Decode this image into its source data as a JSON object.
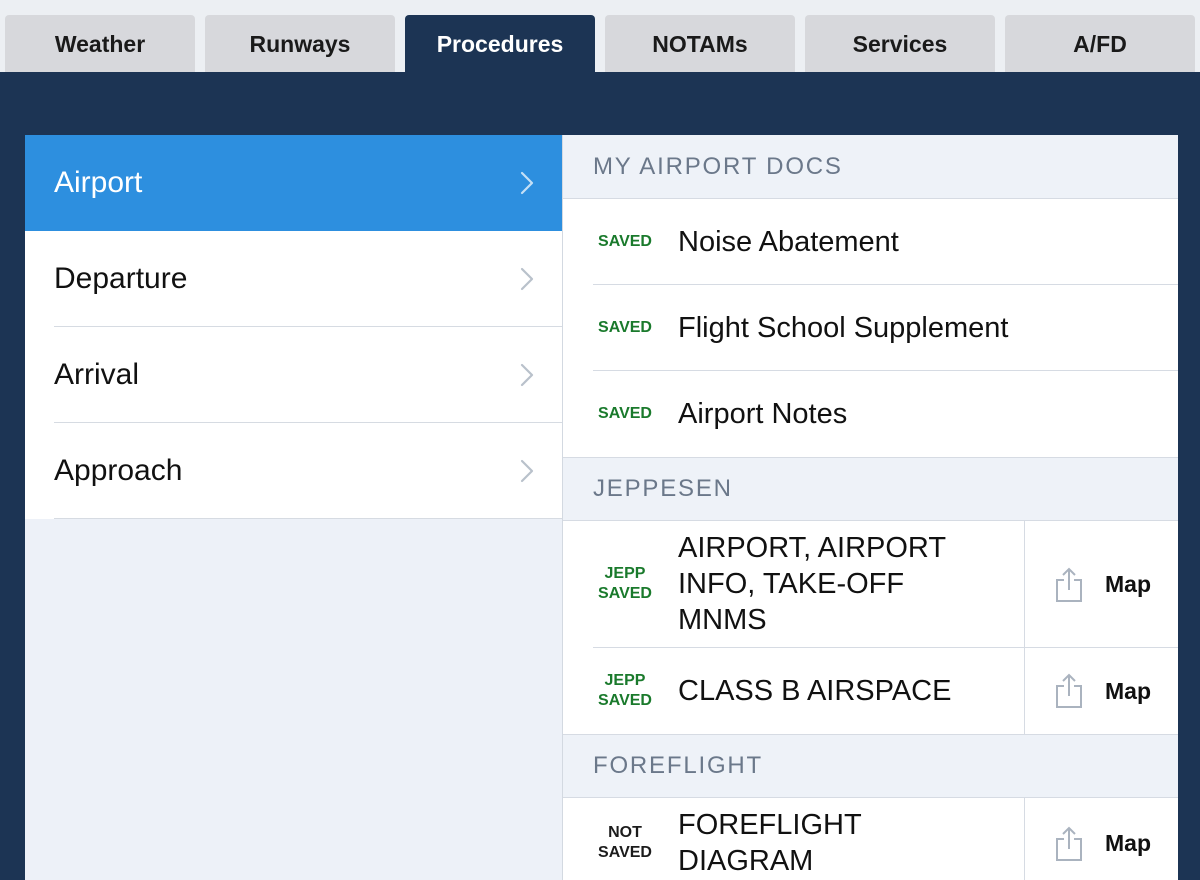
{
  "tabs": [
    {
      "label": "Weather",
      "active": false
    },
    {
      "label": "Runways",
      "active": false
    },
    {
      "label": "Procedures",
      "active": true
    },
    {
      "label": "NOTAMs",
      "active": false
    },
    {
      "label": "Services",
      "active": false
    },
    {
      "label": "A/FD",
      "active": false
    }
  ],
  "sidebar": {
    "item_icon": "chevron-right-icon",
    "items": [
      {
        "label": "Airport",
        "selected": true
      },
      {
        "label": "Departure",
        "selected": false
      },
      {
        "label": "Arrival",
        "selected": false
      },
      {
        "label": "Approach",
        "selected": false
      }
    ]
  },
  "documents": {
    "action_icon": "share-icon",
    "sections": [
      {
        "header": "MY AIRPORT DOCS",
        "rows": [
          {
            "status": "SAVED",
            "saved": true,
            "title": "Noise Abatement"
          },
          {
            "status": "SAVED",
            "saved": true,
            "title": "Flight School Supplement"
          },
          {
            "status": "SAVED",
            "saved": true,
            "title": "Airport Notes"
          }
        ]
      },
      {
        "header": "JEPPESEN",
        "rows": [
          {
            "status": "JEPP SAVED",
            "saved": true,
            "title": "AIRPORT, AIRPORT INFO, TAKE-OFF MNMS",
            "action": "Map"
          },
          {
            "status": "JEPP SAVED",
            "saved": true,
            "title": "CLASS B AIRSPACE",
            "action": "Map"
          }
        ]
      },
      {
        "header": "FOREFLIGHT",
        "rows": [
          {
            "status": "NOT SAVED",
            "saved": false,
            "title": "FOREFLIGHT DIAGRAM",
            "action": "Map"
          }
        ]
      }
    ]
  },
  "colors": {
    "nav": "#1c3454",
    "accent": "#2d8fdf",
    "saved": "#1a7a2c"
  }
}
